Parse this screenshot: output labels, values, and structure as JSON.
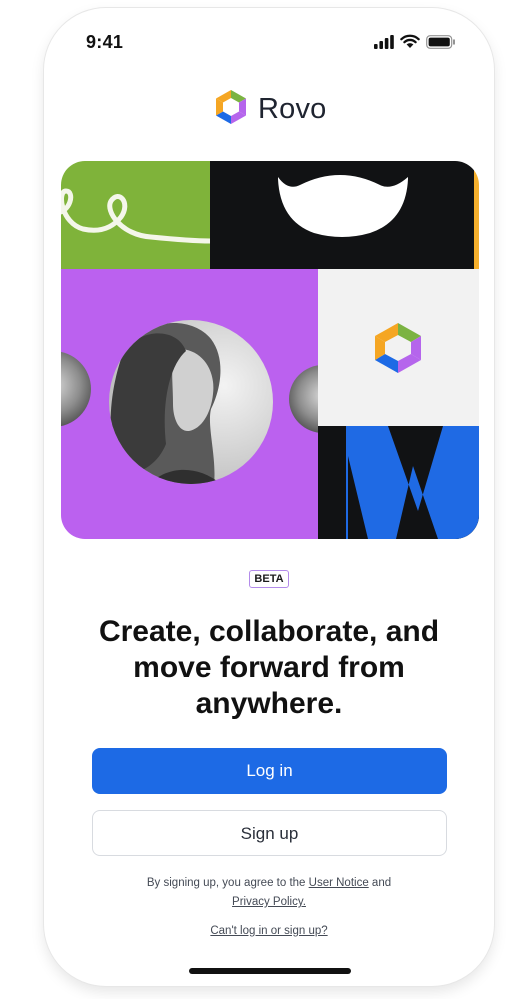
{
  "status_bar": {
    "time": "9:41",
    "icons": [
      "cellular-signal-icon",
      "wifi-icon",
      "battery-icon"
    ]
  },
  "brand": {
    "name": "Rovo",
    "logo": "rovo-logo",
    "logo_colors": [
      "#f5a623",
      "#7bb342",
      "#b565ec",
      "#1d6ae5"
    ]
  },
  "hero": {
    "tile_colors": {
      "green": "#7fb33a",
      "black": "#111214",
      "purple": "#bb61ef",
      "light": "#f2f2f2",
      "blue": "#1f6ae4",
      "yellow": "#f6b02d"
    }
  },
  "badge": "BETA",
  "headline": "Create, collaborate, and move forward from anywhere.",
  "actions": {
    "login": "Log in",
    "signup": "Sign up"
  },
  "legal": {
    "prefix": "By signing up, you agree to the",
    "user_notice": "User Notice",
    "and": "and",
    "privacy_policy": "Privacy Policy."
  },
  "help_link": "Can't log in or sign up?",
  "colors": {
    "primary": "#1d6ae5",
    "badge_border": "#b38bea"
  }
}
